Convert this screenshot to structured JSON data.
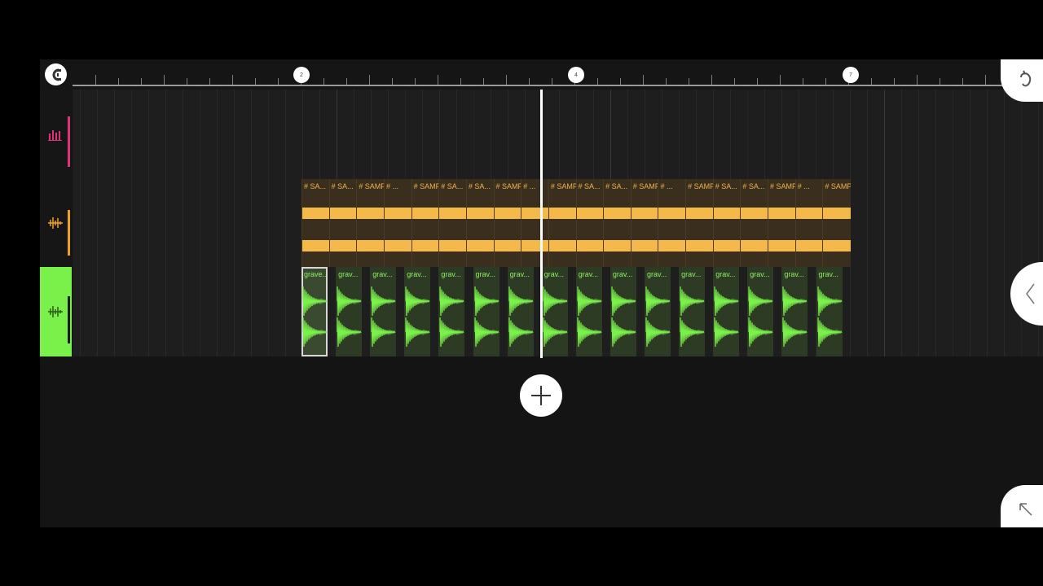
{
  "ruler": {
    "markers": [
      "2",
      "4",
      "7"
    ]
  },
  "tracks": [
    {
      "name": "automation-track",
      "color": "#e0327a",
      "icon": "bars-icon"
    },
    {
      "name": "sample-track",
      "color": "#f0a020",
      "icon": "waveform-icon"
    },
    {
      "name": "drum-track",
      "color": "#7af04a",
      "icon": "waveform-icon",
      "selected": true
    }
  ],
  "orange_clips": [
    "# SA...",
    "# SA...",
    "# SAMP...",
    "# ...",
    "# SAMP...",
    "# SA...",
    "# SA...",
    "# SAMP...",
    "# ...",
    "# SAMP...",
    "# SA...",
    "# SA...",
    "# SAMP...",
    "# ...",
    "# SAMP...",
    "# SA...",
    "# SA...",
    "# SAMP...",
    "# ...",
    "# SAMP..."
  ],
  "green_clips": [
    "grave...",
    "grav...",
    "grav...",
    "grav...",
    "grav...",
    "grav...",
    "grav...",
    "grav...",
    "grav...",
    "grav...",
    "grav...",
    "grav...",
    "grav...",
    "grav...",
    "grav...",
    "grav..."
  ],
  "colors": {
    "accent_pink": "#e0327a",
    "accent_orange": "#f5b94a",
    "accent_green": "#7af04a"
  },
  "icons": {
    "snap": "magnet-snap-icon",
    "add": "plus-icon",
    "collapse": "chevron-left-icon",
    "expand": "arrow-expand-icon",
    "brand": "fruit-logo-icon"
  }
}
